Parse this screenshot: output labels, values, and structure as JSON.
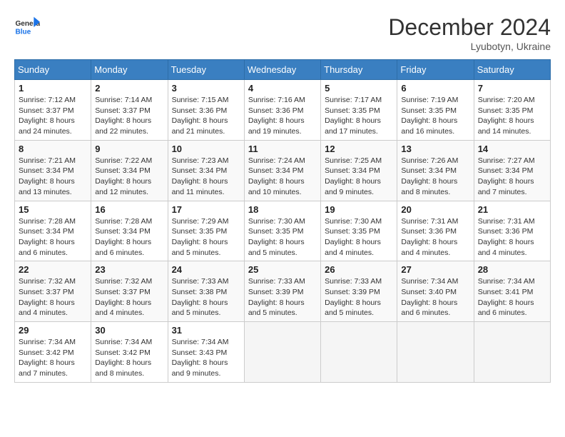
{
  "header": {
    "logo_text_general": "General",
    "logo_text_blue": "Blue",
    "month_title": "December 2024",
    "location": "Lyubotyn, Ukraine"
  },
  "calendar": {
    "days_of_week": [
      "Sunday",
      "Monday",
      "Tuesday",
      "Wednesday",
      "Thursday",
      "Friday",
      "Saturday"
    ],
    "weeks": [
      [
        {
          "day": "1",
          "sunrise": "7:12 AM",
          "sunset": "3:37 PM",
          "daylight": "8 hours and 24 minutes."
        },
        {
          "day": "2",
          "sunrise": "7:14 AM",
          "sunset": "3:37 PM",
          "daylight": "8 hours and 22 minutes."
        },
        {
          "day": "3",
          "sunrise": "7:15 AM",
          "sunset": "3:36 PM",
          "daylight": "8 hours and 21 minutes."
        },
        {
          "day": "4",
          "sunrise": "7:16 AM",
          "sunset": "3:36 PM",
          "daylight": "8 hours and 19 minutes."
        },
        {
          "day": "5",
          "sunrise": "7:17 AM",
          "sunset": "3:35 PM",
          "daylight": "8 hours and 17 minutes."
        },
        {
          "day": "6",
          "sunrise": "7:19 AM",
          "sunset": "3:35 PM",
          "daylight": "8 hours and 16 minutes."
        },
        {
          "day": "7",
          "sunrise": "7:20 AM",
          "sunset": "3:35 PM",
          "daylight": "8 hours and 14 minutes."
        }
      ],
      [
        {
          "day": "8",
          "sunrise": "7:21 AM",
          "sunset": "3:34 PM",
          "daylight": "8 hours and 13 minutes."
        },
        {
          "day": "9",
          "sunrise": "7:22 AM",
          "sunset": "3:34 PM",
          "daylight": "8 hours and 12 minutes."
        },
        {
          "day": "10",
          "sunrise": "7:23 AM",
          "sunset": "3:34 PM",
          "daylight": "8 hours and 11 minutes."
        },
        {
          "day": "11",
          "sunrise": "7:24 AM",
          "sunset": "3:34 PM",
          "daylight": "8 hours and 10 minutes."
        },
        {
          "day": "12",
          "sunrise": "7:25 AM",
          "sunset": "3:34 PM",
          "daylight": "8 hours and 9 minutes."
        },
        {
          "day": "13",
          "sunrise": "7:26 AM",
          "sunset": "3:34 PM",
          "daylight": "8 hours and 8 minutes."
        },
        {
          "day": "14",
          "sunrise": "7:27 AM",
          "sunset": "3:34 PM",
          "daylight": "8 hours and 7 minutes."
        }
      ],
      [
        {
          "day": "15",
          "sunrise": "7:28 AM",
          "sunset": "3:34 PM",
          "daylight": "8 hours and 6 minutes."
        },
        {
          "day": "16",
          "sunrise": "7:28 AM",
          "sunset": "3:34 PM",
          "daylight": "8 hours and 6 minutes."
        },
        {
          "day": "17",
          "sunrise": "7:29 AM",
          "sunset": "3:35 PM",
          "daylight": "8 hours and 5 minutes."
        },
        {
          "day": "18",
          "sunrise": "7:30 AM",
          "sunset": "3:35 PM",
          "daylight": "8 hours and 5 minutes."
        },
        {
          "day": "19",
          "sunrise": "7:30 AM",
          "sunset": "3:35 PM",
          "daylight": "8 hours and 4 minutes."
        },
        {
          "day": "20",
          "sunrise": "7:31 AM",
          "sunset": "3:36 PM",
          "daylight": "8 hours and 4 minutes."
        },
        {
          "day": "21",
          "sunrise": "7:31 AM",
          "sunset": "3:36 PM",
          "daylight": "8 hours and 4 minutes."
        }
      ],
      [
        {
          "day": "22",
          "sunrise": "7:32 AM",
          "sunset": "3:37 PM",
          "daylight": "8 hours and 4 minutes."
        },
        {
          "day": "23",
          "sunrise": "7:32 AM",
          "sunset": "3:37 PM",
          "daylight": "8 hours and 4 minutes."
        },
        {
          "day": "24",
          "sunrise": "7:33 AM",
          "sunset": "3:38 PM",
          "daylight": "8 hours and 5 minutes."
        },
        {
          "day": "25",
          "sunrise": "7:33 AM",
          "sunset": "3:39 PM",
          "daylight": "8 hours and 5 minutes."
        },
        {
          "day": "26",
          "sunrise": "7:33 AM",
          "sunset": "3:39 PM",
          "daylight": "8 hours and 5 minutes."
        },
        {
          "day": "27",
          "sunrise": "7:34 AM",
          "sunset": "3:40 PM",
          "daylight": "8 hours and 6 minutes."
        },
        {
          "day": "28",
          "sunrise": "7:34 AM",
          "sunset": "3:41 PM",
          "daylight": "8 hours and 6 minutes."
        }
      ],
      [
        {
          "day": "29",
          "sunrise": "7:34 AM",
          "sunset": "3:42 PM",
          "daylight": "8 hours and 7 minutes."
        },
        {
          "day": "30",
          "sunrise": "7:34 AM",
          "sunset": "3:42 PM",
          "daylight": "8 hours and 8 minutes."
        },
        {
          "day": "31",
          "sunrise": "7:34 AM",
          "sunset": "3:43 PM",
          "daylight": "8 hours and 9 minutes."
        },
        null,
        null,
        null,
        null
      ]
    ],
    "labels": {
      "sunrise": "Sunrise:",
      "sunset": "Sunset:",
      "daylight": "Daylight:"
    }
  }
}
